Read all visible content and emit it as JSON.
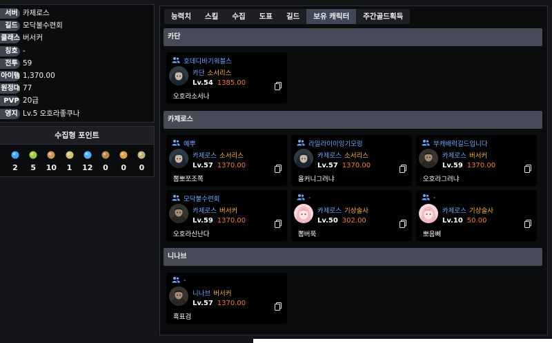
{
  "profile": [
    {
      "label": "서버",
      "value": "카제로스"
    },
    {
      "label": "길드",
      "value": "모닥불수련회"
    },
    {
      "label": "클래스",
      "value": "버서커"
    },
    {
      "label": "칭호",
      "value": "-"
    },
    {
      "label": "전투",
      "value": "59"
    },
    {
      "label": "아이템",
      "value": "1,370.00"
    },
    {
      "label": "원정대",
      "value": "77"
    },
    {
      "label": "PVP",
      "value": "20급"
    },
    {
      "label": "영지",
      "value": "Lv.5 오호라좋쿠나"
    }
  ],
  "collection": {
    "title": "수집형 포인트",
    "items": [
      {
        "icon": "island-heart-icon",
        "value": "2",
        "color": "#3ba7ff"
      },
      {
        "icon": "mokoko-seed-icon",
        "value": "5",
        "color": "#9ccf3a"
      },
      {
        "icon": "adventure-painting-icon",
        "value": "10",
        "color": "#c79a5a"
      },
      {
        "icon": "giant-heart-icon",
        "value": "1",
        "color": "#d8c27a"
      },
      {
        "icon": "ignea-token-icon",
        "value": "12",
        "color": "#4fb0ff"
      },
      {
        "icon": "omnium-star-icon",
        "value": "0",
        "color": "#b5884a"
      },
      {
        "icon": "art-of-war-icon",
        "value": "0",
        "color": "#e0a040"
      },
      {
        "icon": "sea-bounty-icon",
        "value": "0",
        "color": "#c9b07a"
      }
    ]
  },
  "tabs": [
    {
      "label": "능력치",
      "active": false
    },
    {
      "label": "스킬",
      "active": false
    },
    {
      "label": "수집",
      "active": false
    },
    {
      "label": "도표",
      "active": false
    },
    {
      "label": "길드",
      "active": false
    },
    {
      "label": "보유 캐릭터",
      "active": true
    },
    {
      "label": "주간골드획득",
      "active": false
    }
  ],
  "servers": [
    {
      "name": "카단",
      "characters": [
        {
          "guild": "호데디바기워블스",
          "server": "카단",
          "class": "소서리스",
          "level": "Lv.54",
          "item_level": "1385.00",
          "name": "오호라소서나",
          "avatar": "sorc"
        }
      ]
    },
    {
      "name": "카제로스",
      "characters": [
        {
          "guild": "예뿌",
          "server": "카제로스",
          "class": "소서리스",
          "level": "Lv.57",
          "item_level": "1370.00",
          "name": "뽑뽀쪼조쪽",
          "avatar": "sorc"
        },
        {
          "guild": "라일라이이잉기모링",
          "server": "카제로스",
          "class": "소서리스",
          "level": "Lv.57",
          "item_level": "1370.00",
          "name": "올커니그려냐",
          "avatar": "sorc"
        },
        {
          "guild": "부캐배럭길드입니다",
          "server": "카제로스",
          "class": "버서커",
          "level": "Lv.59",
          "item_level": "1370.00",
          "name": "오호라그려냐",
          "avatar": "zerk"
        },
        {
          "guild": "모닥불수련회",
          "server": "카제로스",
          "class": "버서커",
          "level": "Lv.59",
          "item_level": "1370.00",
          "name": "오호라신난다",
          "avatar": "zerk"
        },
        {
          "guild": "-",
          "server": "카제로스",
          "class": "기상술사",
          "level": "Lv.50",
          "item_level": "302.00",
          "name": "뽑버쭉",
          "avatar": "aero"
        },
        {
          "guild": "-",
          "server": "카제로스",
          "class": "기상술사",
          "level": "Lv.10",
          "item_level": "50.00",
          "name": "뽀음삐",
          "avatar": "aero"
        }
      ]
    },
    {
      "name": "니나브",
      "characters": [
        {
          "guild": "-",
          "server": "니나브",
          "class": "버서커",
          "level": "Lv.57",
          "item_level": "1370.00",
          "name": "흑표검",
          "avatar": "zerk"
        }
      ]
    }
  ]
}
